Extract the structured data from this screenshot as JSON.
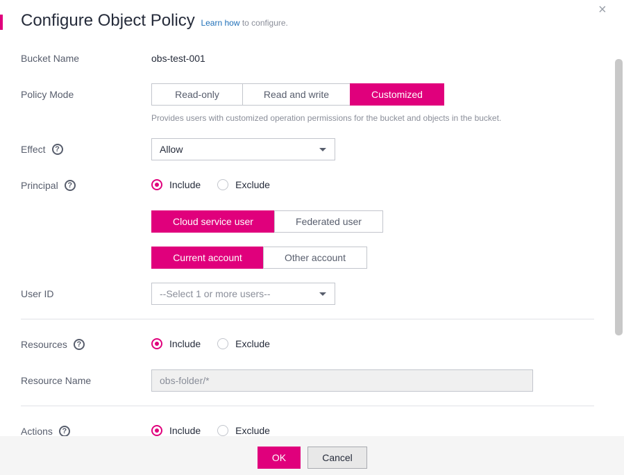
{
  "dialog": {
    "title": "Configure Object Policy",
    "learn_link": "Learn how",
    "learn_suffix": " to configure.",
    "close_glyph": "×"
  },
  "bucket": {
    "label": "Bucket Name",
    "value": "obs-test-001"
  },
  "policy_mode": {
    "label": "Policy Mode",
    "options": [
      "Read-only",
      "Read and write",
      "Customized"
    ],
    "selected": "Customized",
    "hint": "Provides users with customized operation permissions for the bucket and objects in the bucket."
  },
  "effect": {
    "label": "Effect",
    "value": "Allow"
  },
  "principal": {
    "label": "Principal",
    "include": "Include",
    "exclude": "Exclude",
    "selected": "Include",
    "user_type": {
      "options": [
        "Cloud service user",
        "Federated user"
      ],
      "selected": "Cloud service user"
    },
    "account": {
      "options": [
        "Current account",
        "Other account"
      ],
      "selected": "Current account"
    }
  },
  "user_id": {
    "label": "User ID",
    "placeholder": "--Select 1 or more users--"
  },
  "resources": {
    "label": "Resources",
    "include": "Include",
    "exclude": "Exclude",
    "selected": "Include"
  },
  "resource_name": {
    "label": "Resource Name",
    "value": "obs-folder/*"
  },
  "actions": {
    "label": "Actions",
    "include": "Include",
    "exclude": "Exclude",
    "selected": "Include"
  },
  "footer": {
    "ok_label": "OK",
    "cancel_label": "Cancel"
  },
  "icons": {
    "help": "help-circle-icon",
    "caret": "chevron-down-icon",
    "close": "close-icon"
  },
  "colors": {
    "accent": "#e0007c",
    "link": "#1e6fb8"
  }
}
